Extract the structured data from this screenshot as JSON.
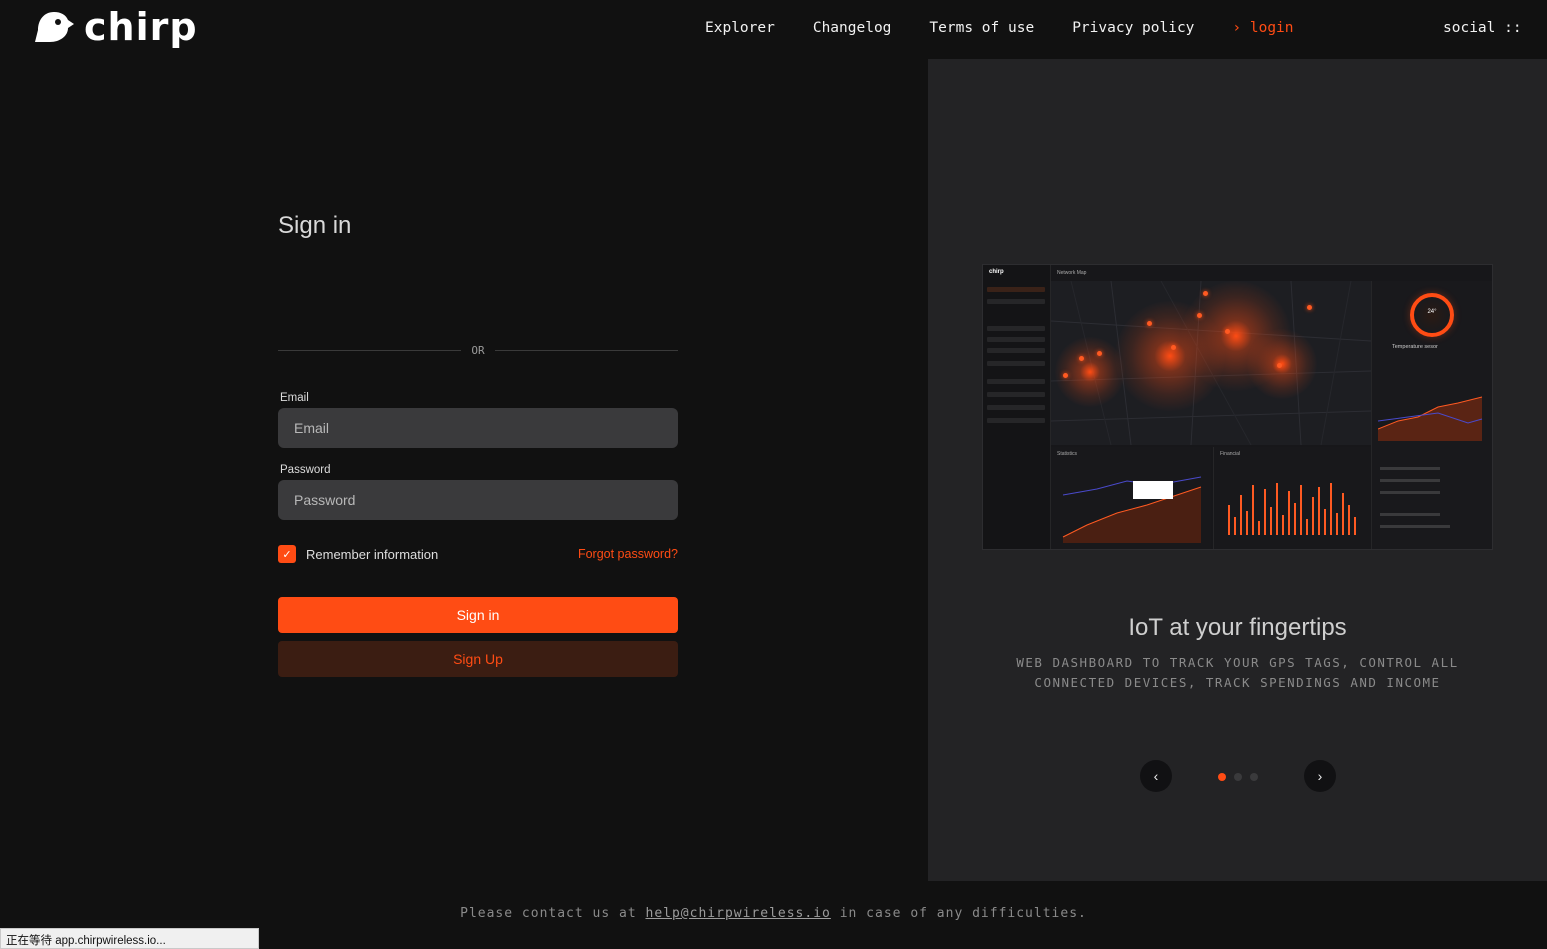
{
  "header": {
    "logo_text": "chirp",
    "nav": [
      "Explorer",
      "Changelog",
      "Terms of use",
      "Privacy policy"
    ],
    "active_nav": "› login",
    "social": "social ::"
  },
  "form": {
    "title": "Sign in",
    "divider": "OR",
    "email_label": "Email",
    "email_placeholder": "Email",
    "password_label": "Password",
    "password_placeholder": "Password",
    "remember_label": "Remember information",
    "remember_checked": true,
    "forgot": "Forgot password?",
    "signin_button": "Sign in",
    "signup_button": "Sign Up"
  },
  "promo": {
    "title": "IoT at your fingertips",
    "description": "WEB DASHBOARD TO TRACK YOUR GPS TAGS, CONTROL ALL CONNECTED DEVICES, TRACK SPENDINGS AND INCOME",
    "prev_icon": "‹",
    "next_icon": "›",
    "slide_count": 3,
    "active_slide": 0,
    "preview": {
      "logo": "chirp",
      "map_label": "Network Map",
      "gauge_value": "24°",
      "sensor_label": "Temperature sesor",
      "stats_label": "Statistics",
      "financial_label": "Financial"
    }
  },
  "footer": {
    "before": "Please contact us at ",
    "email": "help@chirpwireless.io",
    "after": " in case of any difficulties."
  },
  "status_bar": "正在等待 app.chirpwireless.io...",
  "colors": {
    "accent": "#ff4c14",
    "background": "#111111",
    "panel": "#232325",
    "field": "#3a3a3c"
  }
}
